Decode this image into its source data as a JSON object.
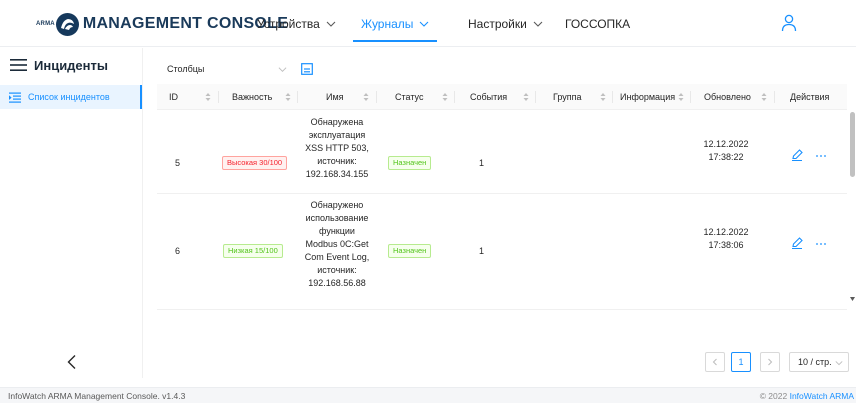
{
  "app": {
    "brand_small": "ARMA",
    "brand_title": "MANAGEMENT CONSOLE"
  },
  "nav": {
    "items": [
      {
        "label": "Устройства",
        "has_dropdown": true
      },
      {
        "label": "Журналы",
        "has_dropdown": true,
        "active": true
      },
      {
        "label": "Настройки",
        "has_dropdown": true
      },
      {
        "label": "ГОССОПКА",
        "has_dropdown": false
      }
    ],
    "user_icon": "user-icon"
  },
  "sidebar": {
    "title": "Инциденты",
    "items": [
      {
        "label": "Список инцидентов",
        "active": true
      }
    ]
  },
  "toolbar": {
    "columns_label": "Столбцы"
  },
  "table": {
    "columns": [
      "ID",
      "Важность",
      "Имя",
      "Статус",
      "События",
      "Группа",
      "Информация",
      "Обновлено",
      "Действия"
    ],
    "rows": [
      {
        "id": "5",
        "severity": "Высокая 30/100",
        "severity_level": "high",
        "name_lines": [
          "Обнаружена",
          "эксплуатация",
          "XSS HTTP 503,",
          "источник:",
          "192.168.34.155"
        ],
        "status": "Назначен",
        "events": "1",
        "group": "",
        "info": "",
        "updated_date": "12.12.2022",
        "updated_time": "17:38:22"
      },
      {
        "id": "6",
        "severity": "Низкая 15/100",
        "severity_level": "low",
        "name_lines": [
          "Обнаружено",
          "использование",
          "функции",
          "Modbus 0C:Get",
          "Com Event Log,",
          "источник:",
          "192.168.56.88"
        ],
        "status": "Назначен",
        "events": "1",
        "group": "",
        "info": "",
        "updated_date": "12.12.2022",
        "updated_time": "17:38:06"
      }
    ]
  },
  "pagination": {
    "current_page": "1",
    "page_size": "10 / стр."
  },
  "footer": {
    "version": "InfoWatch ARMA Management Console. v1.4.3",
    "copyright": "© 2022 ",
    "copyright_link": "InfoWatch ARMA"
  },
  "colors": {
    "accent": "#1890ff",
    "brand": "#16395c",
    "severity_high": "#f5222d",
    "severity_low": "#52c41a",
    "status_assigned": "#52c41a"
  }
}
